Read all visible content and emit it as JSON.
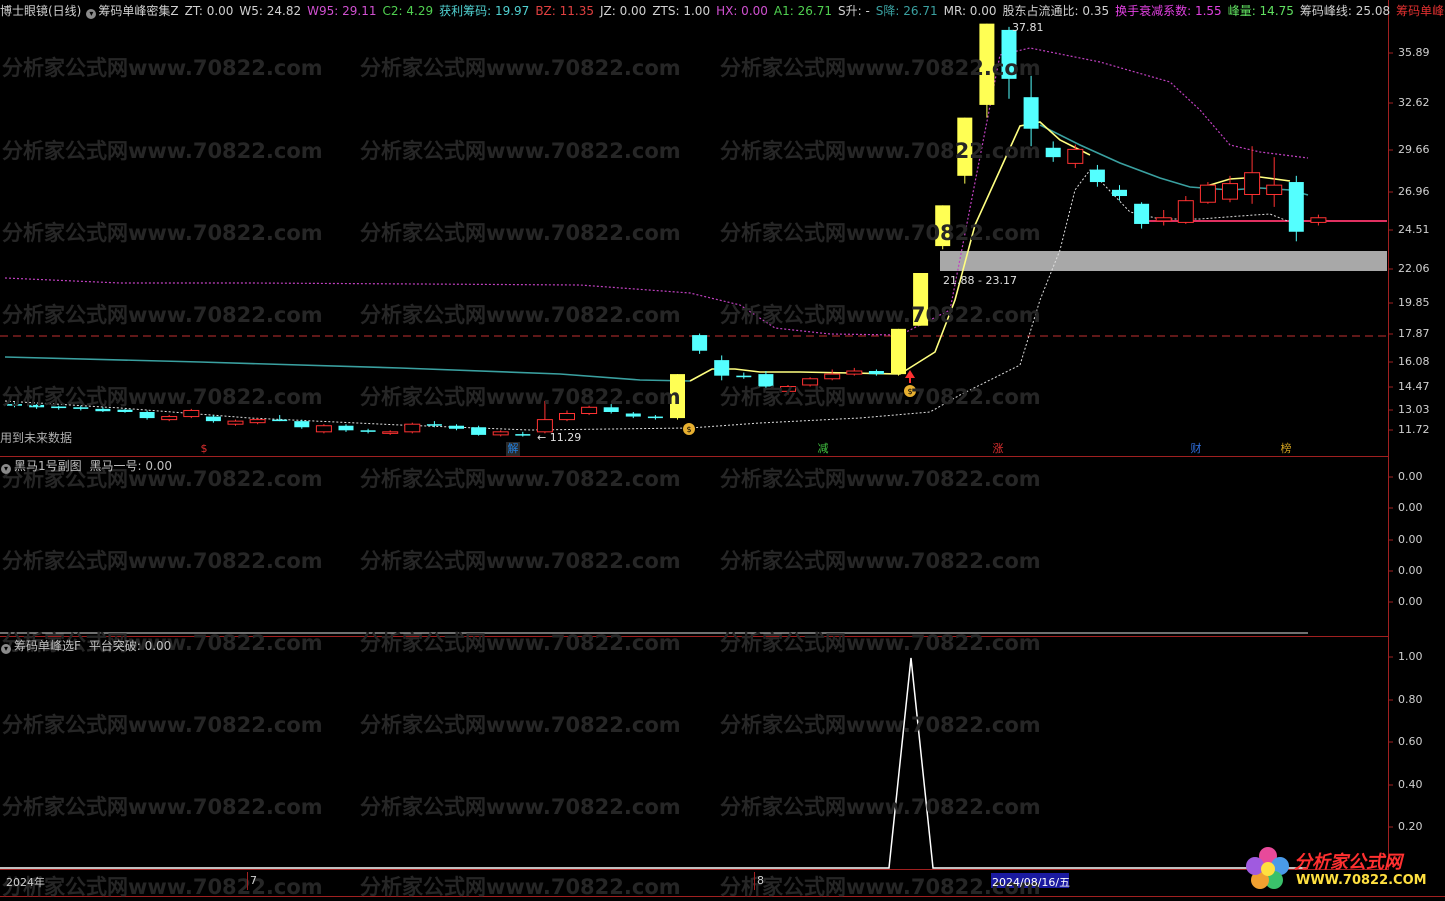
{
  "main_panel": {
    "items": [
      {
        "label": "博士眼镜(日线)",
        "color": "#d0d0d0"
      },
      {
        "label": "筹码单峰密集Z",
        "color": "#d0d0d0"
      },
      {
        "label": "ZT: 0.00",
        "color": "#d0d0d0"
      },
      {
        "label": "W5: 24.82",
        "color": "#d0d0d0"
      },
      {
        "label": "W95: 29.11",
        "color": "#d050d0"
      },
      {
        "label": "C2: 4.29",
        "color": "#50d050"
      },
      {
        "label": "获利筹码: 19.97",
        "color": "#50d0d0"
      },
      {
        "label": "BZ: 11.35",
        "color": "#e04040"
      },
      {
        "label": "JZ: 0.00",
        "color": "#d0d0d0"
      },
      {
        "label": "ZTS: 1.00",
        "color": "#d0d0d0"
      },
      {
        "label": "HX: 0.00",
        "color": "#d050d0"
      },
      {
        "label": "A1: 26.71",
        "color": "#50d050"
      },
      {
        "label": "S升: -",
        "color": "#d0d0d0"
      },
      {
        "label": "S降: 26.71",
        "color": "#3aa0a0"
      },
      {
        "label": "MR: 0.00",
        "color": "#d0d0d0"
      },
      {
        "label": "股东占流通比: 0.35",
        "color": "#d0d0d0"
      },
      {
        "label": "换手衰减系数: 1.55",
        "color": "#e040e0"
      },
      {
        "label": "峰量: 14.75",
        "color": "#60e060"
      },
      {
        "label": "筹码峰线: 25.08",
        "color": "#d0d0d0"
      },
      {
        "label": "筹码单峰密◇",
        "color": "#e03030"
      }
    ],
    "yticks": [
      "35.89",
      "32.62",
      "29.66",
      "26.96",
      "24.51",
      "22.06",
      "19.85",
      "17.87",
      "16.08",
      "14.47",
      "13.03",
      "11.72"
    ],
    "annotations": {
      "peak": "37.81",
      "low": "← 11.29",
      "band": "21.88 - 23.17",
      "future": "用到未来数据"
    },
    "event_marks": [
      {
        "label": "$",
        "color": "#e03030"
      },
      {
        "label": "解",
        "color": "#2080e0"
      },
      {
        "label": "减",
        "color": "#40c040"
      },
      {
        "label": "涨",
        "color": "#e03030"
      },
      {
        "label": "财",
        "color": "#3070e0"
      },
      {
        "label": "榜",
        "color": "#d0a020"
      }
    ]
  },
  "sub_panel_1": {
    "title": "黑马1号副图",
    "value": "黑马一号: 0.00",
    "yticks": [
      "0.00",
      "0.00",
      "0.00",
      "0.00",
      "0.00"
    ]
  },
  "sub_panel_2": {
    "title": "筹码单峰选F",
    "value": "平台突破: 0.00",
    "yticks": [
      "1.00",
      "0.80",
      "0.60",
      "0.40",
      "0.20"
    ]
  },
  "x_axis": {
    "labels": [
      "2024年",
      "7",
      "8",
      "2024/08/16/五"
    ]
  },
  "watermark": {
    "text": "分析家公式网www.70822.com"
  },
  "logo": {
    "name": "分析家公式网",
    "url": "WWW.70822.COM"
  },
  "colors": {
    "up": "#ff3232",
    "down": "#54ffff",
    "bigup": "#ffff54",
    "ma": "#e8e860",
    "band": "#a8a8a8"
  },
  "chart_data": {
    "type": "candlestick",
    "ylim": [
      11,
      38
    ],
    "candles": [
      {
        "o": 13.4,
        "c": 13.3,
        "h": 13.5,
        "l": 13.2
      },
      {
        "o": 13.35,
        "c": 13.2,
        "h": 13.4,
        "l": 13.1
      },
      {
        "o": 13.25,
        "c": 13.15,
        "h": 13.3,
        "l": 13.05
      },
      {
        "o": 13.2,
        "c": 13.1,
        "h": 13.3,
        "l": 13.0
      },
      {
        "o": 13.1,
        "c": 12.95,
        "h": 13.2,
        "l": 12.9
      },
      {
        "o": 13.05,
        "c": 12.9,
        "h": 13.1,
        "l": 12.85
      },
      {
        "o": 12.9,
        "c": 12.5,
        "h": 13.0,
        "l": 12.4
      },
      {
        "o": 12.4,
        "c": 12.6,
        "h": 12.7,
        "l": 12.3
      },
      {
        "o": 12.6,
        "c": 13.0,
        "h": 13.1,
        "l": 12.5
      },
      {
        "o": 12.6,
        "c": 12.3,
        "h": 12.7,
        "l": 12.2
      },
      {
        "o": 12.1,
        "c": 12.3,
        "h": 12.4,
        "l": 12.0
      },
      {
        "o": 12.2,
        "c": 12.4,
        "h": 12.5,
        "l": 12.1
      },
      {
        "o": 12.4,
        "c": 12.35,
        "h": 12.7,
        "l": 12.3
      },
      {
        "o": 12.3,
        "c": 11.9,
        "h": 12.4,
        "l": 11.8
      },
      {
        "o": 11.6,
        "c": 12.0,
        "h": 12.1,
        "l": 11.5
      },
      {
        "o": 12.0,
        "c": 11.7,
        "h": 12.1,
        "l": 11.6
      },
      {
        "o": 11.7,
        "c": 11.6,
        "h": 11.8,
        "l": 11.5
      },
      {
        "o": 11.5,
        "c": 11.6,
        "h": 11.7,
        "l": 11.4
      },
      {
        "o": 11.6,
        "c": 12.1,
        "h": 12.2,
        "l": 11.5
      },
      {
        "o": 12.1,
        "c": 12.0,
        "h": 12.3,
        "l": 11.9
      },
      {
        "o": 12.0,
        "c": 11.8,
        "h": 12.1,
        "l": 11.7
      },
      {
        "o": 11.9,
        "c": 11.4,
        "h": 12.0,
        "l": 11.35
      },
      {
        "o": 11.4,
        "c": 11.6,
        "h": 11.7,
        "l": 11.3
      },
      {
        "o": 11.45,
        "c": 11.4,
        "h": 11.6,
        "l": 11.29
      },
      {
        "o": 11.6,
        "c": 12.4,
        "h": 13.6,
        "l": 11.5
      },
      {
        "o": 12.4,
        "c": 12.8,
        "h": 13.0,
        "l": 12.3
      },
      {
        "o": 12.8,
        "c": 13.2,
        "h": 13.3,
        "l": 12.7
      },
      {
        "o": 13.2,
        "c": 12.9,
        "h": 13.4,
        "l": 12.8
      },
      {
        "o": 12.8,
        "c": 12.6,
        "h": 12.9,
        "l": 12.5
      },
      {
        "o": 12.6,
        "c": 12.5,
        "h": 12.7,
        "l": 12.4
      },
      {
        "o": 12.5,
        "c": 15.3,
        "h": 15.3,
        "l": 12.4
      },
      {
        "o": 17.8,
        "c": 16.8,
        "h": 17.9,
        "l": 16.6
      },
      {
        "o": 16.2,
        "c": 15.2,
        "h": 16.5,
        "l": 14.9
      },
      {
        "o": 15.2,
        "c": 15.1,
        "h": 15.4,
        "l": 15.0
      },
      {
        "o": 15.3,
        "c": 14.5,
        "h": 15.5,
        "l": 14.3
      },
      {
        "o": 14.2,
        "c": 14.5,
        "h": 14.6,
        "l": 14.0
      },
      {
        "o": 14.6,
        "c": 15.0,
        "h": 15.1,
        "l": 14.5
      },
      {
        "o": 15.0,
        "c": 15.3,
        "h": 15.6,
        "l": 14.9
      },
      {
        "o": 15.3,
        "c": 15.5,
        "h": 15.7,
        "l": 15.2
      },
      {
        "o": 15.5,
        "c": 15.3,
        "h": 15.6,
        "l": 15.2
      },
      {
        "o": 15.3,
        "c": 18.2,
        "h": 18.2,
        "l": 15.2
      },
      {
        "o": 18.4,
        "c": 21.8,
        "h": 21.8,
        "l": 18.4
      },
      {
        "o": 23.5,
        "c": 26.1,
        "h": 26.1,
        "l": 23.3
      },
      {
        "o": 28.0,
        "c": 31.7,
        "h": 31.7,
        "l": 27.5
      },
      {
        "o": 32.5,
        "c": 37.81,
        "h": 37.81,
        "l": 31.7
      },
      {
        "o": 37.4,
        "c": 34.2,
        "h": 37.6,
        "l": 32.9
      },
      {
        "o": 33.0,
        "c": 31.0,
        "h": 34.4,
        "l": 29.9
      },
      {
        "o": 29.8,
        "c": 29.2,
        "h": 30.2,
        "l": 28.9
      },
      {
        "o": 28.8,
        "c": 29.7,
        "h": 30.0,
        "l": 28.5
      },
      {
        "o": 28.4,
        "c": 27.6,
        "h": 28.7,
        "l": 27.3
      },
      {
        "o": 27.1,
        "c": 26.7,
        "h": 27.4,
        "l": 26.4
      },
      {
        "o": 26.2,
        "c": 24.9,
        "h": 26.3,
        "l": 24.6
      },
      {
        "o": 25.1,
        "c": 25.3,
        "h": 25.8,
        "l": 24.8
      },
      {
        "o": 25.0,
        "c": 26.4,
        "h": 26.7,
        "l": 24.9
      },
      {
        "o": 26.3,
        "c": 27.4,
        "h": 27.6,
        "l": 26.2
      },
      {
        "o": 26.5,
        "c": 27.5,
        "h": 28.0,
        "l": 26.3
      },
      {
        "o": 26.8,
        "c": 28.2,
        "h": 29.9,
        "l": 26.2
      },
      {
        "o": 26.8,
        "c": 27.4,
        "h": 29.2,
        "l": 26.0
      },
      {
        "o": 27.6,
        "c": 24.4,
        "h": 28.0,
        "l": 23.8
      },
      {
        "o": 25.0,
        "c": 25.3,
        "h": 25.5,
        "l": 24.8
      }
    ],
    "panel2_signal": {
      "x": [
        0,
        40,
        41,
        42,
        59
      ],
      "y": [
        0,
        0,
        1,
        0,
        0
      ]
    }
  }
}
